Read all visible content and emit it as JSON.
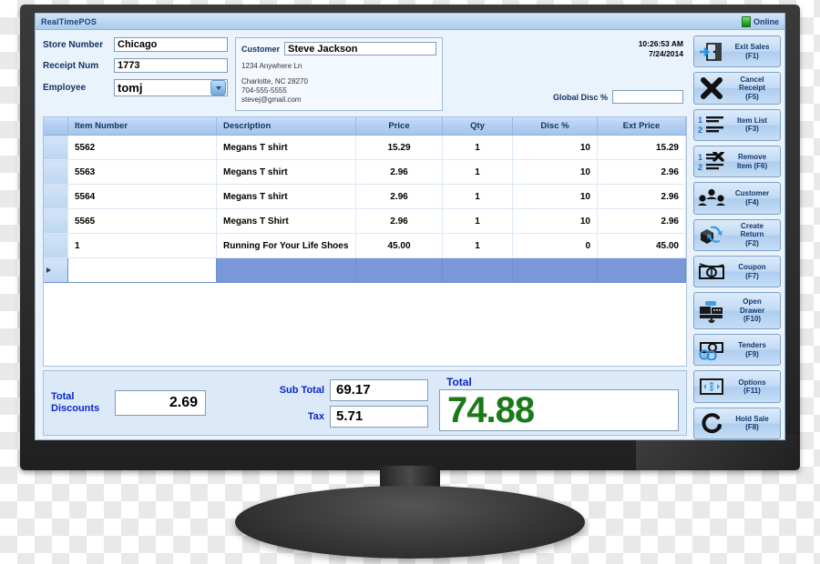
{
  "window": {
    "title": "RealTimePOS",
    "status_label": "Online",
    "status_icon": "green-monitor-icon"
  },
  "form": {
    "store_number_label": "Store Number",
    "store_number_value": "Chicago",
    "receipt_num_label": "Receipt Num",
    "receipt_num_value": "1773",
    "employee_label": "Employee",
    "employee_value": "tomj"
  },
  "customer": {
    "label": "Customer",
    "name": "Steve Jackson",
    "address_line1": "1234 Anywhere Ln",
    "address_line2": "Charlotte, NC 28270",
    "phone": "704-555-5555",
    "email": "stevej@gmail.com"
  },
  "clock": {
    "time": "10:26:53 AM",
    "date": "7/24/2014"
  },
  "global_discount": {
    "label": "Global Disc %",
    "value": ""
  },
  "grid": {
    "columns": [
      "Item Number",
      "Description",
      "Price",
      "Qty",
      "Disc %",
      "Ext Price"
    ],
    "rows": [
      {
        "item": "5562",
        "desc": "Megans T shirt",
        "price": "15.29",
        "qty": "1",
        "disc": "10",
        "ext": "15.29"
      },
      {
        "item": "5563",
        "desc": "Megans T shirt",
        "price": "2.96",
        "qty": "1",
        "disc": "10",
        "ext": "2.96"
      },
      {
        "item": "5564",
        "desc": "Megans T shirt",
        "price": "2.96",
        "qty": "1",
        "disc": "10",
        "ext": "2.96"
      },
      {
        "item": "5565",
        "desc": "Megans T Shirt",
        "price": "2.96",
        "qty": "1",
        "disc": "10",
        "ext": "2.96"
      },
      {
        "item": "1",
        "desc": "Running For Your Life Shoes",
        "price": "45.00",
        "qty": "1",
        "disc": "0",
        "ext": "45.00"
      }
    ],
    "new_row": {
      "item": "",
      "desc": "",
      "price": "",
      "qty": "",
      "disc": "",
      "ext": ""
    }
  },
  "totals": {
    "total_discounts_label": "Total Discounts",
    "total_discounts_value": "2.69",
    "sub_total_label": "Sub Total",
    "sub_total_value": "69.17",
    "tax_label": "Tax",
    "tax_value": "5.71",
    "total_label": "Total",
    "total_value": "74.88",
    "total_color": "#1a7a1a"
  },
  "buttons": [
    {
      "label": "Exit Sales\n(F1)",
      "line1": "Exit Sales",
      "line2": "(F1)",
      "icon": "exit-door-icon",
      "key": "F1"
    },
    {
      "label": "Cancel Receipt (F5)",
      "line1": "Cancel",
      "line2": "Receipt",
      "line3": "(F5)",
      "icon": "black-x-icon",
      "key": "F5"
    },
    {
      "label": "Item List (F3)",
      "line1": "Item List",
      "line2": "(F3)",
      "icon": "numbered-list-icon",
      "key": "F3"
    },
    {
      "label": "Remove Item (F6)",
      "line1": "Remove",
      "line2": "Item (F6)",
      "icon": "list-delete-icon",
      "key": "F6"
    },
    {
      "label": "Customer (F4)",
      "line1": "Customer",
      "line2": "(F4)",
      "icon": "people-group-icon",
      "key": "F4"
    },
    {
      "label": "Create Return (F2)",
      "line1": "Create",
      "line2": "Return",
      "line3": "(F2)",
      "icon": "box-return-arrows-icon",
      "key": "F2"
    },
    {
      "label": "Coupon (F7)",
      "line1": "Coupon",
      "line2": "(F7)",
      "icon": "coupon-money-icon",
      "key": "F7"
    },
    {
      "label": "Open Drawer (F10)",
      "line1": "Open",
      "line2": "Drawer",
      "line3": "(F10)",
      "icon": "cash-drawer-icon",
      "key": "F10"
    },
    {
      "label": "Tenders (F9)",
      "line1": "Tenders",
      "line2": "(F9)",
      "icon": "coins-cash-icon",
      "key": "F9"
    },
    {
      "label": "Options (F11)",
      "line1": "Options",
      "line2": "(F11)",
      "icon": "arrows-screen-icon",
      "key": "F11"
    },
    {
      "label": "Hold Sale (F8)",
      "line1": "Hold Sale",
      "line2": "(F8)",
      "icon": "rotate-arrow-icon",
      "key": "F8"
    }
  ]
}
